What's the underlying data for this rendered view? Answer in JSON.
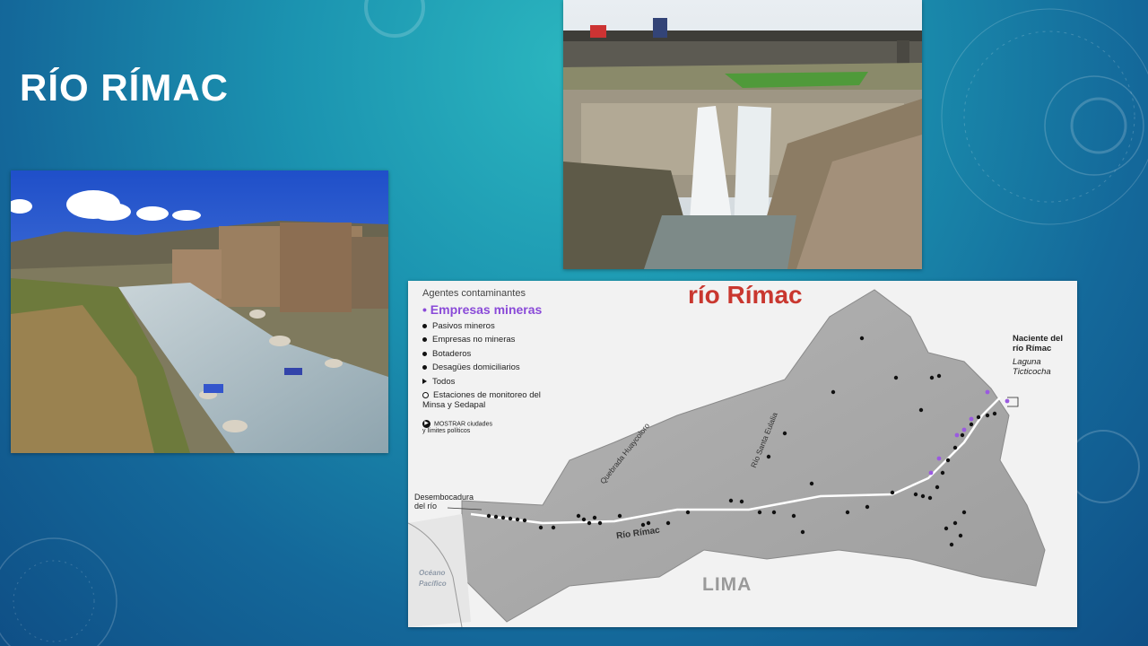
{
  "slide": {
    "title": "RÍO RÍMAC"
  },
  "map": {
    "title": "río Rímac",
    "legend": {
      "heading": "Agentes contaminantes",
      "highlight": "• Empresas mineras",
      "items": [
        "Pasivos mineros",
        "Empresas no mineras",
        "Botaderos",
        "Desagües domiciliarios"
      ],
      "todos": "Todos",
      "stations": "Estaciones de monitoreo del Minsa y Sedapal",
      "show": "MOSTRAR ciudades y límites políticos"
    },
    "labels": {
      "naciente": "Naciente del río Rímac",
      "laguna": "Laguna Ticticocha",
      "desembocadura": "Desembocadura del río",
      "lima": "LIMA",
      "oceano": "Océano Pacífico",
      "rio_rimac": "Río Rímac",
      "huaycoloro": "Quebrada Huaycoloro",
      "santa_eulalia": "Río Santa Eulalia"
    },
    "colors": {
      "title": "#c9372f",
      "mining": "#8a4ad8"
    }
  },
  "images": {
    "river_photo": "mountain-river-photo",
    "dam_photo": "bridge-waterfall-photo"
  }
}
